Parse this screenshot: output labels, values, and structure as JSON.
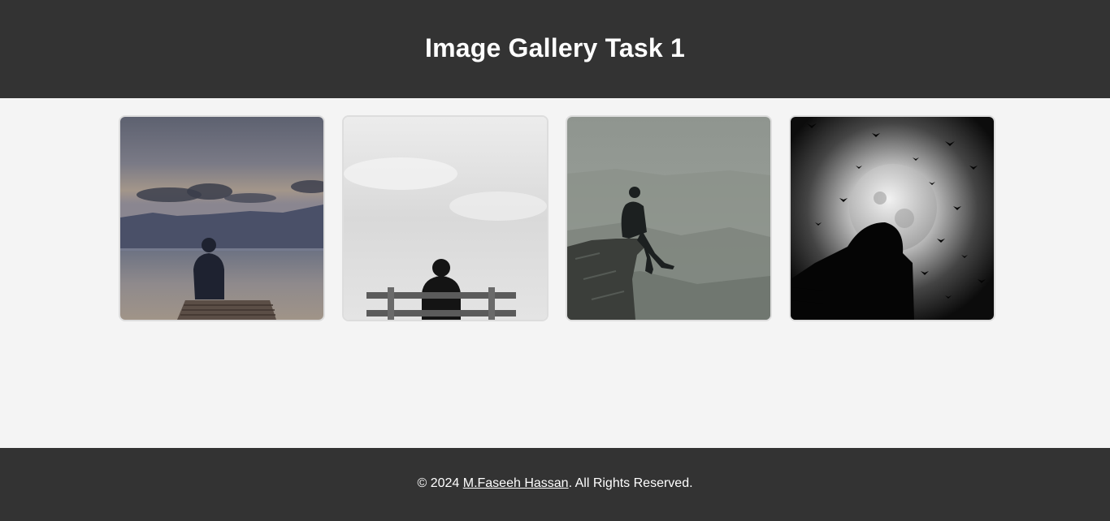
{
  "header": {
    "title": "Image Gallery Task 1"
  },
  "gallery": {
    "images": [
      {
        "subject": "silhouette-on-pier-lake-icon"
      },
      {
        "subject": "silhouette-on-bench-icon"
      },
      {
        "subject": "silhouette-on-cliff-icon"
      },
      {
        "subject": "silhouette-moon-birds-icon"
      }
    ]
  },
  "footer": {
    "prefix": "© 2024 ",
    "author_link": "M.Faseeh Hassan",
    "suffix": ". All Rights Reserved."
  },
  "colors": {
    "header_bg": "#333333",
    "page_bg": "#f4f4f4",
    "footer_bg": "#333333",
    "text_light": "#ffffff"
  }
}
